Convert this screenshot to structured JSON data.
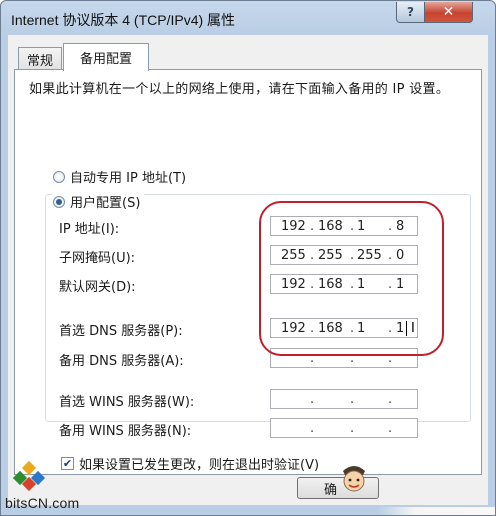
{
  "window": {
    "title": "Internet 协议版本 4 (TCP/IPv4) 属性",
    "help_label": "?",
    "close_label": "✕"
  },
  "tabs": [
    {
      "label": "常规",
      "selected": false
    },
    {
      "label": "备用配置",
      "selected": true
    }
  ],
  "description": "如果此计算机在一个以上的网络上使用，请在下面输入备用的 IP 设置。",
  "options": {
    "auto": {
      "label": "自动专用 IP 地址(T)",
      "selected": false
    },
    "user": {
      "label": "用户配置(S)",
      "selected": true
    }
  },
  "fields": [
    {
      "label": "IP 地址(I):",
      "octets": [
        "192",
        "168",
        "1",
        "8"
      ]
    },
    {
      "label": "子网掩码(U):",
      "octets": [
        "255",
        "255",
        "255",
        "0"
      ]
    },
    {
      "label": "默认网关(D):",
      "octets": [
        "192",
        "168",
        "1",
        "1"
      ]
    },
    {
      "label": "首选 DNS 服务器(P):",
      "octets": [
        "192",
        "168",
        "1",
        "1"
      ]
    },
    {
      "label": "备用 DNS 服务器(A):",
      "octets": [
        "",
        "",
        "",
        ""
      ]
    },
    {
      "label": "首选 WINS 服务器(W):",
      "octets": [
        "",
        "",
        "",
        ""
      ]
    },
    {
      "label": "备用 WINS 服务器(N):",
      "octets": [
        "",
        "",
        "",
        ""
      ]
    }
  ],
  "validate_checkbox": {
    "label": "如果设置已发生更改，则在退出时验证(V)",
    "checked": true
  },
  "ok_button": {
    "label": "确"
  },
  "watermark": {
    "text": "bitsCN.com"
  },
  "colors": {
    "highlight": "#c0202b",
    "title_bar": "#b9cde4",
    "close_button": "#c5442f"
  }
}
